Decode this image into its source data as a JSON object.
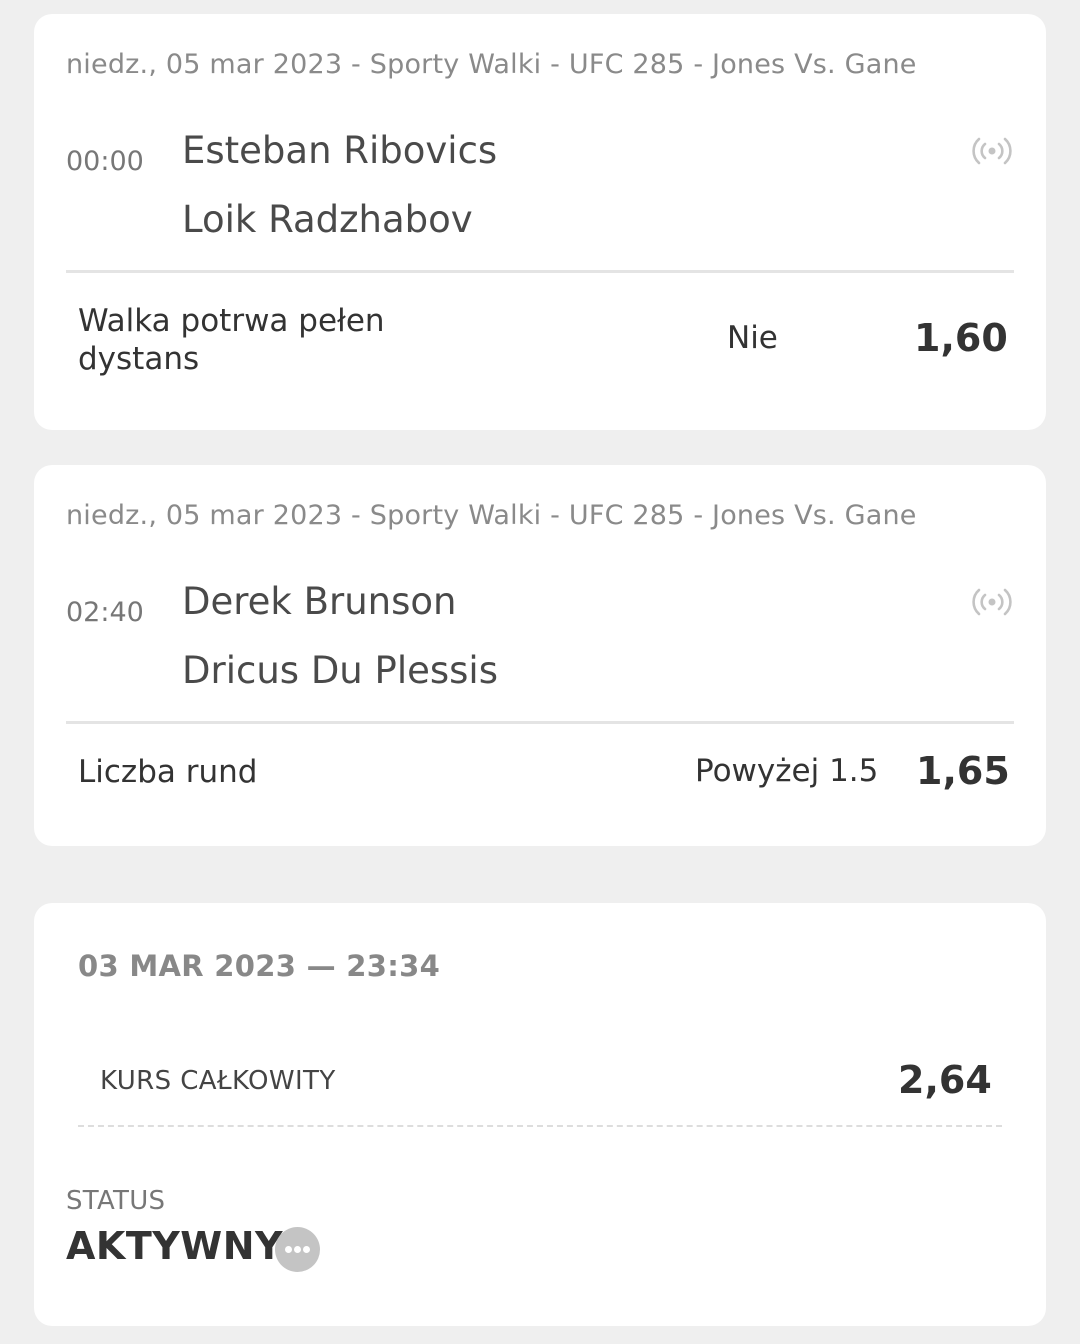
{
  "bets": [
    {
      "meta": "niedz., 05 mar 2023 - Sporty Walki - UFC 285 - Jones Vs. Gane",
      "time": "00:00",
      "team1": "Esteban Ribovics",
      "team2": "Loik Radzhabov",
      "market": "Walka potrwa pełen dystans",
      "selection": "Nie",
      "odds": "1,60",
      "icon": "live-broadcast-icon"
    },
    {
      "meta": "niedz., 05 mar 2023 - Sporty Walki - UFC 285 - Jones Vs. Gane",
      "time": "02:40",
      "team1": "Derek Brunson",
      "team2": "Dricus Du Plessis",
      "market": "Liczba rund",
      "selection": "Powyżej 1.5",
      "odds": "1,65",
      "icon": "live-broadcast-icon"
    }
  ],
  "summary": {
    "placed_at": "03 MAR 2023 — 23:34",
    "total_label": "KURS CAŁKOWITY",
    "total_value": "2,64",
    "status_label": "STATUS",
    "status_value": "AKTYWNY",
    "more_icon": "more-options-icon"
  },
  "colors": {
    "background": "#efefef",
    "card": "#ffffff",
    "text_primary": "#333333",
    "text_muted": "#8a8a8a",
    "icon_gray": "#c4c4c4"
  }
}
